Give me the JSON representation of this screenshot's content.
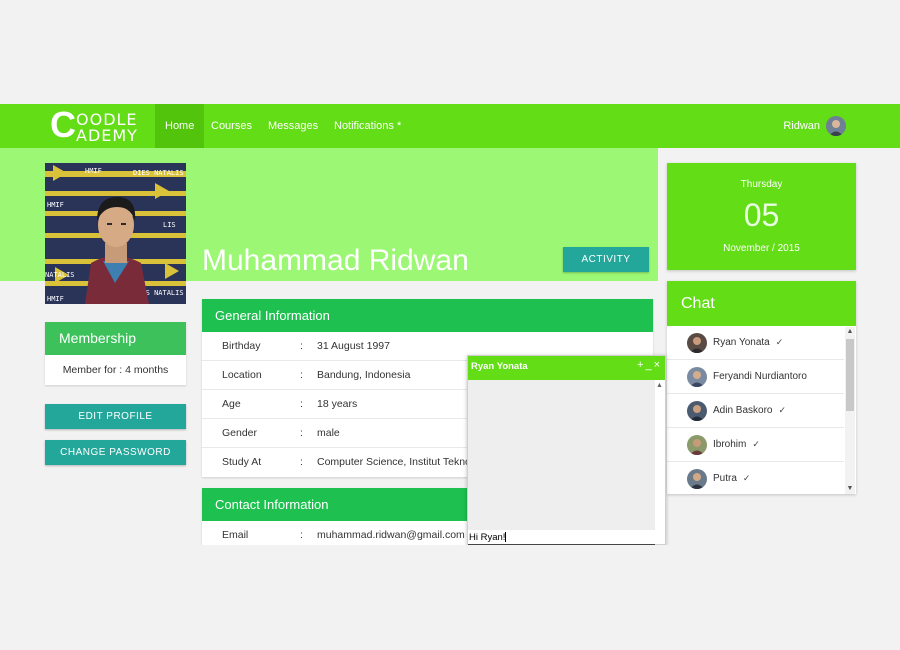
{
  "app": {
    "logo_line1": "OODLE",
    "logo_line2": "ADEMY",
    "logo_mark": "C"
  },
  "nav": {
    "items": [
      {
        "label": "Home",
        "active": true
      },
      {
        "label": "Courses",
        "active": false
      },
      {
        "label": "Messages",
        "active": false
      },
      {
        "label": "Notifications *",
        "active": false
      }
    ],
    "user_name": "Ridwan"
  },
  "profile": {
    "name": "Muhammad Ridwan",
    "activity_label": "ACTIVITY",
    "photo_banner_text": "HMIF  DIES NATALIS"
  },
  "membership": {
    "title": "Membership",
    "text": "Member for : 4 months"
  },
  "actions": {
    "edit_profile": "EDIT PROFILE",
    "change_password": "CHANGE PASSWORD"
  },
  "general": {
    "title": "General Information",
    "rows": [
      {
        "key": "Birthday",
        "value": "31 August 1997"
      },
      {
        "key": "Location",
        "value": "Bandung, Indonesia"
      },
      {
        "key": "Age",
        "value": "18 years"
      },
      {
        "key": "Gender",
        "value": "male"
      },
      {
        "key": "Study At",
        "value": "Computer Science, Institut Teknol"
      }
    ]
  },
  "contact": {
    "title": "Contact Information",
    "rows": [
      {
        "key": "Email",
        "value": "muhammad.ridwan@gmail.com"
      }
    ]
  },
  "date": {
    "day": "Thursday",
    "number": "05",
    "month_year": "November / 2015"
  },
  "chat": {
    "title": "Chat",
    "contacts": [
      {
        "name": "Ryan Yonata",
        "check": "✓"
      },
      {
        "name": "Feryandi Nurdiantoro",
        "check": ""
      },
      {
        "name": "Adin Baskoro",
        "check": "✓"
      },
      {
        "name": "Ibrohim",
        "check": "✓"
      },
      {
        "name": "Putra",
        "check": "✓"
      }
    ]
  },
  "popup": {
    "title": "Ryan Yonata",
    "controls": "+_×",
    "message_input": "Hi Ryan!"
  },
  "colors": {
    "brand_green": "#62dd16",
    "band_green": "#9cf874",
    "panel_green": "#1ec04f",
    "teal": "#23a79a"
  }
}
